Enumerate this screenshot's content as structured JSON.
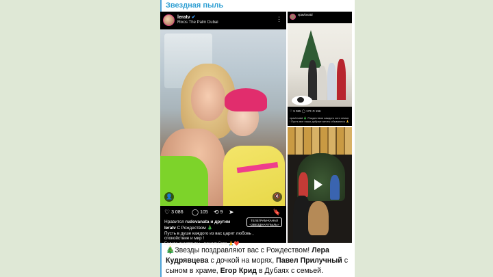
{
  "channel": {
    "title": "Звездная пыль"
  },
  "post_main": {
    "username": "leratv",
    "location": "Rixos The Palm Dubai",
    "likes": "3 086",
    "comments": "105",
    "reposts": "9",
    "liked_by_prefix": "Нравится",
    "liked_by_user": "rudovanata",
    "liked_by_suffix": "и другим",
    "watermark_top": "ТЕЛЕГРАМ-КАНАЛ",
    "watermark_bottom": "«ЗВЕЗДНАЯ ПЫЛЬ»",
    "caption_user": "leratv",
    "caption_lines": [
      "С Рождеством 🎄",
      "Пусть в душе каждого из вас царит любовь ,",
      "спокойствие и мир !",
      "Будьте счастливы , пожалуйста 🙏❤️"
    ]
  },
  "post_right_top": {
    "username": "vpavlovatd",
    "stats": "♡ 9 085   ◯ 173   ⟲ 196",
    "watermark": "«ЗВЕЗДНАЯ ПЫЛЬ»",
    "caption": "vpavlovatd 🎄 Рождеством каждого кого семья ! Пусть все наши добрые мечты сбываются 🙏"
  },
  "post_right_bottom": {
    "media": "video"
  },
  "caption": {
    "emoji": "🎄",
    "part1": "Звезды поздравляют вас с Рождеством! ",
    "name1": "Лера Кудрявцева",
    "part2": " с дочкой на морях, ",
    "name2": "Павел Прилучный",
    "part3": " с сыном в храме, ",
    "name3": "Егор Крид",
    "part4": " в Дубаях с семьей."
  }
}
